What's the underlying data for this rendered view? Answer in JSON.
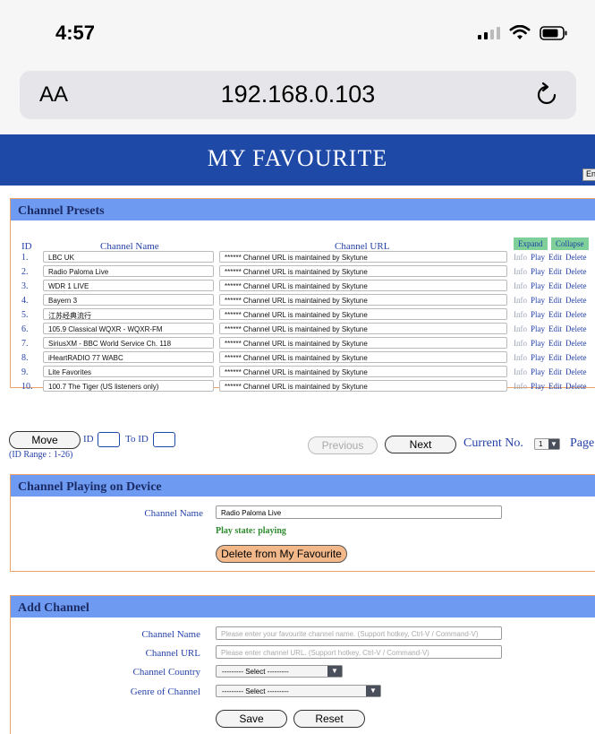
{
  "status_bar": {
    "time": "4:57"
  },
  "browser": {
    "aa": "AA",
    "url": "192.168.0.103"
  },
  "header": {
    "title": "MY FAVOURITE",
    "lang_button": "En"
  },
  "presets": {
    "section_title": "Channel Presets",
    "columns": {
      "id": "ID",
      "name": "Channel Name",
      "url": "Channel URL"
    },
    "expand_label": "Expand",
    "collapse_label": "Collapse",
    "action_labels": {
      "info": "Info",
      "play": "Play",
      "edit": "Edit",
      "delete": "Delete"
    },
    "rows": [
      {
        "id": "1.",
        "name": "LBC UK",
        "url": "****** Channel URL is maintained by Skytune"
      },
      {
        "id": "2.",
        "name": "Radio Paloma Live",
        "url": "****** Channel URL is maintained by Skytune"
      },
      {
        "id": "3.",
        "name": "WDR 1 LIVE",
        "url": "****** Channel URL is maintained by Skytune"
      },
      {
        "id": "4.",
        "name": "Bayern 3",
        "url": "****** Channel URL is maintained by Skytune"
      },
      {
        "id": "5.",
        "name": "江苏经典流行",
        "url": "****** Channel URL is maintained by Skytune"
      },
      {
        "id": "6.",
        "name": "105.9 Classical WQXR - WQXR-FM",
        "url": "****** Channel URL is maintained by Skytune"
      },
      {
        "id": "7.",
        "name": "SiriusXM - BBC World Service Ch. 118",
        "url": "****** Channel URL is maintained by Skytune"
      },
      {
        "id": "8.",
        "name": "iHeartRADIO 77 WABC",
        "url": "****** Channel URL is maintained by Skytune"
      },
      {
        "id": "9.",
        "name": "Lite Favorites",
        "url": "****** Channel URL is maintained by Skytune"
      },
      {
        "id": "10.",
        "name": "100.7 The Tiger (US listeners only)",
        "url": "****** Channel URL is maintained by Skytune"
      }
    ]
  },
  "move": {
    "button": "Move",
    "id_label": "ID",
    "to_id_label": "To ID",
    "range": "(ID Range : 1-26)"
  },
  "pager": {
    "previous": "Previous",
    "next": "Next",
    "current_label": "Current No.",
    "current_value": "1",
    "page_label": "Page"
  },
  "playing": {
    "section_title": "Channel Playing on Device",
    "name_label": "Channel Name",
    "name_value": "Radio Paloma Live",
    "state": "Play state: playing",
    "delete_button": "Delete from My Favourite"
  },
  "add": {
    "section_title": "Add Channel",
    "name_label": "Channel Name",
    "name_placeholder": "Please enter your favourite channel name. (Support hotkey, Ctrl-V / Command-V)",
    "url_label": "Channel URL",
    "url_placeholder": "Please enter channel URL. (Support hotkey, Ctrl-V / Command-V)",
    "country_label": "Channel Country",
    "country_value": "--------- Select ---------",
    "genre_label": "Genre of Channel",
    "genre_value": "--------- Select ---------",
    "save": "Save",
    "reset": "Reset"
  }
}
